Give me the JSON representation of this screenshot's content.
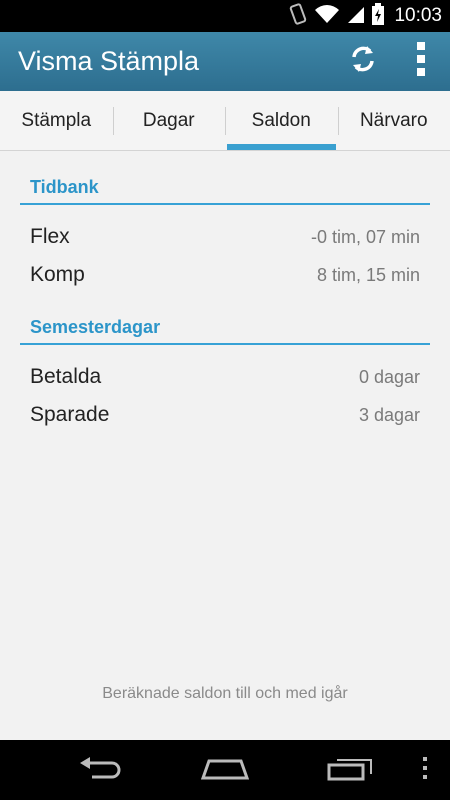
{
  "status_bar": {
    "time": "10:03",
    "icons": [
      "vibrate-icon",
      "wifi-icon",
      "signal-icon",
      "battery-icon"
    ]
  },
  "action_bar": {
    "title": "Visma Stämpla",
    "actions": [
      "refresh-icon",
      "overflow-menu-icon"
    ]
  },
  "tabs": [
    {
      "label": "Stämpla"
    },
    {
      "label": "Dagar"
    },
    {
      "label": "Saldon",
      "active": true
    },
    {
      "label": "Närvaro"
    }
  ],
  "sections": [
    {
      "title": "Tidbank",
      "rows": [
        {
          "label": "Flex",
          "value": "-0 tim, 07 min"
        },
        {
          "label": "Komp",
          "value": "8 tim, 15 min"
        }
      ]
    },
    {
      "title": "Semesterdagar",
      "rows": [
        {
          "label": "Betalda",
          "value": "0 dagar"
        },
        {
          "label": "Sparade",
          "value": "3 dagar"
        }
      ]
    }
  ],
  "footer": "Beräknade saldon till och med igår",
  "nav_bar": [
    "back-icon",
    "home-icon",
    "recent-apps-icon",
    "menu-icon"
  ],
  "colors": {
    "accent": "#38a2d6",
    "action_bar": "#3a7fa0"
  }
}
